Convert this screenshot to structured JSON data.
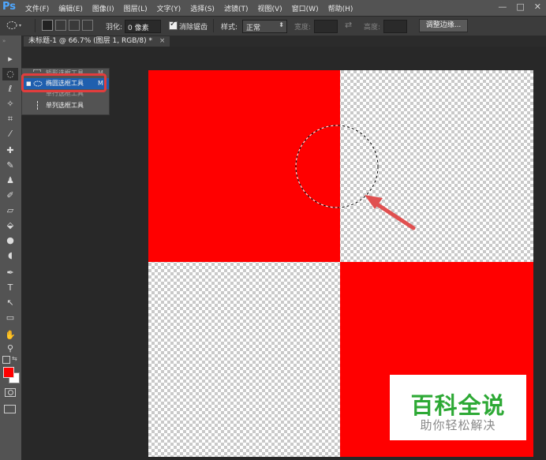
{
  "app": {
    "logo": "Ps",
    "menu": [
      "文件(F)",
      "编辑(E)",
      "图像(I)",
      "图层(L)",
      "文字(Y)",
      "选择(S)",
      "滤镜(T)",
      "视图(V)",
      "窗口(W)",
      "帮助(H)"
    ],
    "window_controls": [
      "—",
      "□",
      "✕"
    ]
  },
  "options_bar": {
    "feather_label": "羽化:",
    "feather_value": "0 像素",
    "antialias_label": "消除锯齿",
    "antialias_checked": true,
    "style_label": "样式:",
    "style_value": "正常",
    "width_label": "宽度:",
    "height_label": "高度:",
    "swap_glyph": "⇄",
    "refine_button": "调整边缘..."
  },
  "document_tab": {
    "title": "未标题-1 @ 66.7% (图层 1, RGB/8) *",
    "close": "×"
  },
  "tools": [
    {
      "icon": "move-icon",
      "glyph": "▸"
    },
    {
      "icon": "marquee-icon",
      "glyph": "◌"
    },
    {
      "icon": "lasso-icon",
      "glyph": "ℓ"
    },
    {
      "icon": "magic-wand-icon",
      "glyph": "✧"
    },
    {
      "icon": "crop-icon",
      "glyph": "⌗"
    },
    {
      "icon": "eyedropper-icon",
      "glyph": "⁄"
    },
    {
      "icon": "healing-icon",
      "glyph": "✚"
    },
    {
      "icon": "brush-icon",
      "glyph": "✎"
    },
    {
      "icon": "stamp-icon",
      "glyph": "♟"
    },
    {
      "icon": "history-brush-icon",
      "glyph": "✐"
    },
    {
      "icon": "eraser-icon",
      "glyph": "▱"
    },
    {
      "icon": "bucket-icon",
      "glyph": "⬙"
    },
    {
      "icon": "blur-icon",
      "glyph": "●"
    },
    {
      "icon": "dodge-icon",
      "glyph": "◖"
    },
    {
      "icon": "pen-icon",
      "glyph": "✒"
    },
    {
      "icon": "type-icon",
      "glyph": "T"
    },
    {
      "icon": "path-select-icon",
      "glyph": "↖"
    },
    {
      "icon": "shape-icon",
      "glyph": "▭"
    },
    {
      "icon": "hand-icon",
      "glyph": "✋"
    },
    {
      "icon": "zoom-icon",
      "glyph": "⚲"
    }
  ],
  "colors": {
    "foreground": "#ff0000",
    "background": "#ffffff",
    "red": "#ff0000",
    "accent_blue": "#1f5fae",
    "highlight": "#e23d3d"
  },
  "flyout": {
    "items": [
      {
        "label": "矩形选框工具",
        "shortcut": "M"
      },
      {
        "label": "椭圆选框工具",
        "shortcut": "M"
      },
      {
        "label": "单行选框工具",
        "shortcut": ""
      },
      {
        "label": "单列选框工具",
        "shortcut": ""
      }
    ],
    "selected_index": 1
  },
  "watermark": {
    "big": "百科全说",
    "small": "助你轻松解决"
  }
}
